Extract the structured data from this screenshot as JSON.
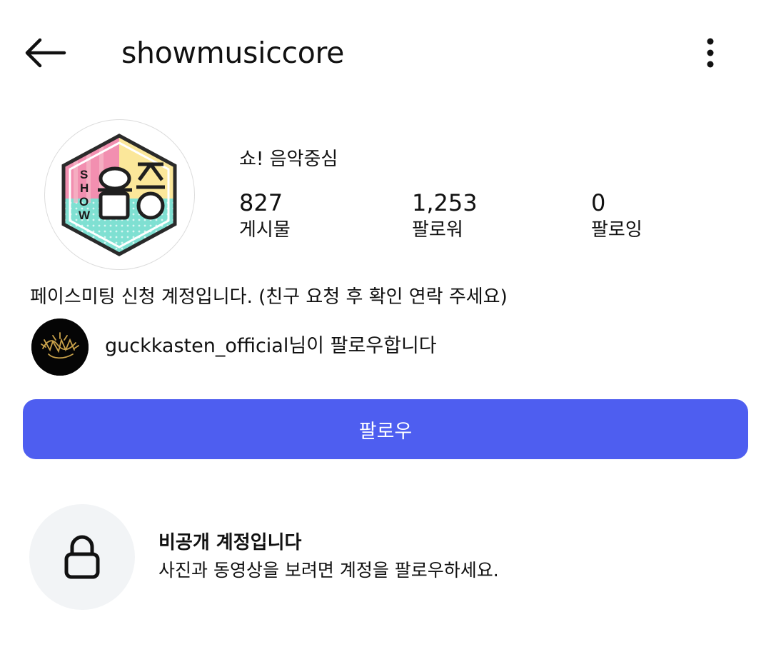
{
  "header": {
    "username": "showmusiccore",
    "back_icon": "arrow-left-icon",
    "more_icon": "more-vertical-icon"
  },
  "profile": {
    "full_name": "쇼! 음악중심",
    "avatar_text": "SHOW 음중",
    "stats": {
      "posts": {
        "value": "827",
        "label": "게시물"
      },
      "followers": {
        "value": "1,253",
        "label": "팔로워"
      },
      "following": {
        "value": "0",
        "label": "팔로잉"
      }
    },
    "bio": "페이스미팅 신청 계정입니다. (친구 요청 후 확인 연락 주세요)"
  },
  "followed_by": {
    "username": "guckkasten_official",
    "suffix": "님이 팔로우합니다"
  },
  "actions": {
    "follow_label": "팔로우",
    "follow_color": "#4e5ef0"
  },
  "private_notice": {
    "icon": "lock-icon",
    "title": "비공개 계정입니다",
    "description": "사진과 동영상을 보려면 계정을 팔로우하세요."
  }
}
